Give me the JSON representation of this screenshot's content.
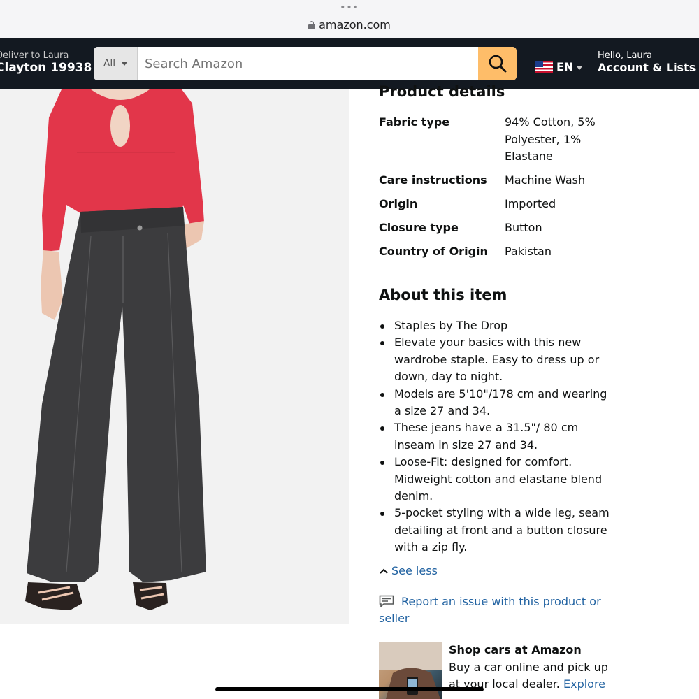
{
  "browser": {
    "menu_dots": "•••",
    "url": "amazon.com"
  },
  "header": {
    "deliver_line1": "Deliver to Laura",
    "deliver_line2": "Clayton 19938",
    "search_category": "All",
    "search_placeholder": "Search Amazon",
    "language": "EN",
    "account_hello": "Hello, Laura",
    "account_lists": "Account & Lists"
  },
  "product_details": {
    "title": "Product details",
    "rows": [
      {
        "key": "Fabric type",
        "value": "94% Cotton, 5% Polyester, 1% Elastane"
      },
      {
        "key": "Care instructions",
        "value": "Machine Wash"
      },
      {
        "key": "Origin",
        "value": "Imported"
      },
      {
        "key": "Closure type",
        "value": "Button"
      },
      {
        "key": "Country of Origin",
        "value": "Pakistan"
      }
    ]
  },
  "about": {
    "title": "About this item",
    "bullets": [
      "Staples by The Drop",
      "Elevate your basics with this new wardrobe staple. Easy to dress up or down, day to night.",
      "Models are 5'10\"/178 cm and wearing a size 27 and 34.",
      "These jeans have a 31.5\"/ 80 cm inseam in size 27 and 34.",
      "Loose-Fit: designed for comfort. Midweight cotton and elastane blend denim.",
      "5-pocket styling with a wide leg, seam detailing at front and a button closure with a zip fly."
    ],
    "see_less": "See less",
    "report": "Report an issue with this product or seller"
  },
  "ad": {
    "title": "Shop cars at Amazon",
    "text": "Buy a car online and pick up at your local dealer.",
    "link": "Explore"
  },
  "colors": {
    "header_bg": "#131921",
    "search_button": "#febd69",
    "link": "#2162a1",
    "top_red": "#e2364a",
    "denim": "#3c3c3e"
  }
}
